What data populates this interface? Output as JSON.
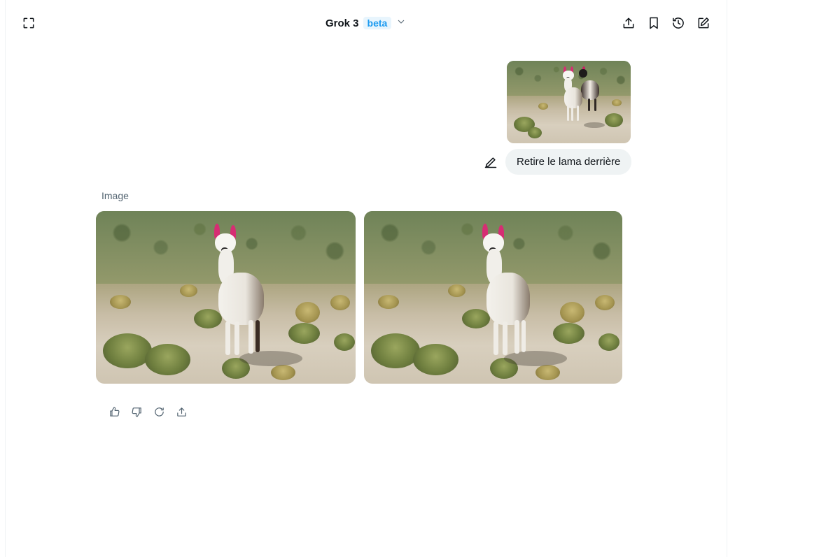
{
  "header": {
    "model_name": "Grok 3",
    "model_badge": "beta",
    "icons": {
      "expand": "expand-icon",
      "share": "share-icon",
      "bookmark": "bookmark-icon",
      "history": "history-icon",
      "new_chat": "compose-icon",
      "dropdown": "chevron-down-icon"
    }
  },
  "conversation": {
    "user_message": {
      "text": "Retire le lama derrière",
      "edit_icon": "edit-pencil-icon"
    },
    "assistant_message": {
      "label": "Image",
      "actions": [
        "thumbs-up-icon",
        "thumbs-down-icon",
        "regenerate-icon",
        "share-icon"
      ]
    }
  },
  "colors": {
    "accent": "#1d9bf0",
    "bubble_bg": "#eff3f4",
    "muted_text": "#536471",
    "text": "#0f1419"
  }
}
